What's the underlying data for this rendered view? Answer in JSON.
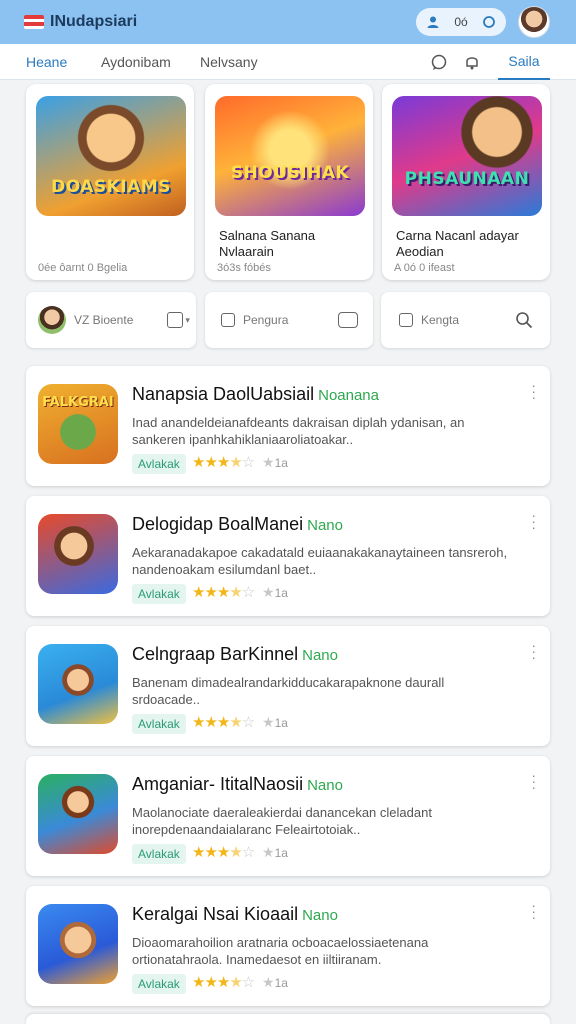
{
  "app": {
    "title": "INudapsiari",
    "pill_text": "0ó"
  },
  "tabs": {
    "home": "Heane",
    "second": "Aydonibam",
    "third": "Nelvsany",
    "active": "Saila"
  },
  "featured": [
    {
      "art_text": "DOASKIAMS",
      "title": "",
      "meta": "0ée ôarnt 0 Bgelia"
    },
    {
      "art_text": "SHOUSIHAK",
      "title": "Salnana Sanana Nvlaarain",
      "meta": "3ó3s fóbés"
    },
    {
      "art_text": "PHSAUNAAN",
      "title": "Carna Nacanl adayar Aeodian",
      "meta": "A 0ó 0 ifeast"
    }
  ],
  "chips": [
    {
      "label": "VZ Bioente"
    },
    {
      "label": "Pengura"
    },
    {
      "label": "Kengta"
    }
  ],
  "apps": [
    {
      "name": "Nanapsia DaolUabsiail",
      "accent": "Noanana",
      "desc": "Inad anandeldeianafdeants dakraisan diplah ydanisan, an sankeren ipanhkahiklaniaaroliatoakar..",
      "badge": "Avlakak",
      "rating": 3.5,
      "rating_count": "1a"
    },
    {
      "name": "Delogidap BoalManei",
      "accent": "Nano",
      "desc": "Aekaranadakapoe cakadatald euiaanakakanaytaineen tansreroh, nandenoakam esilumdanl baet..",
      "badge": "Avlakak",
      "rating": 3.5,
      "rating_count": "1a"
    },
    {
      "name": "Celngraap BarKinnel",
      "accent": "Nano",
      "desc": "Banenam dimadealrandarkidducakarapaknone daurall srdoacade..",
      "badge": "Avlakak",
      "rating": 3.5,
      "rating_count": "1a"
    },
    {
      "name": "Amganiar- ItitalNaosii",
      "accent": "Nano",
      "desc": "Maolanociate daeraleakierdai danancekan cleladant inorepdenaandaialaranc Feleairtotoiak..",
      "badge": "Avlakak",
      "rating": 3.5,
      "rating_count": "1a"
    },
    {
      "name": "Keralgai Nsai Kioaail",
      "accent": "Nano",
      "desc": "Dioaomarahoilion aratnaria ocboacaelossiaetenana ortionatahraola. Inamedaesot en iiltiiranam.",
      "badge": "Avlakak",
      "rating": 3.5,
      "rating_count": "1a"
    }
  ],
  "colors": {
    "topbar": "#8cc2f2",
    "accent_green": "#2fa84f",
    "tab_active": "#2a7bbf",
    "star": "#f2b619"
  }
}
